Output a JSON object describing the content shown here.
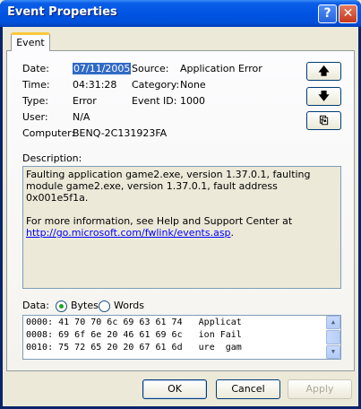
{
  "window": {
    "title": "Event Properties",
    "help_glyph": "?",
    "close_glyph": "✕"
  },
  "tab": {
    "label": "Event"
  },
  "fields": {
    "date_label": "Date:",
    "date_value": "07/11/2005",
    "time_label": "Time:",
    "time_value": "04:31:28",
    "type_label": "Type:",
    "type_value": "Error",
    "user_label": "User:",
    "user_value": "N/A",
    "computer_label": "Computer:",
    "computer_value": "BENQ-2C131923FA",
    "source_label": "Source:",
    "source_value": "Application Error",
    "category_label": "Category:",
    "category_value": "None",
    "eventid_label": "Event ID:",
    "eventid_value": "1000"
  },
  "side_buttons": {
    "up": "🡅",
    "down": "🡇",
    "copy": "⎘"
  },
  "description": {
    "label": "Description:",
    "line1": "Faulting application game2.exe, version 1.37.0.1, faulting module game2.exe, version 1.37.0.1, fault address 0x001e5f1a.",
    "line2": "For more information, see Help and Support Center at",
    "link": "http://go.microsoft.com/fwlink/events.asp",
    "link_suffix": "."
  },
  "data": {
    "label": "Data:",
    "bytes_label": "Bytes",
    "words_label": "Words",
    "selected": "Bytes",
    "rows": [
      "0000: 41 70 70 6c 69 63 61 74   Applicat",
      "0008: 69 6f 6e 20 46 61 69 6c   ion Fail",
      "0010: 75 72 65 20 20 67 61 6d   ure  gam"
    ]
  },
  "buttons": {
    "ok": "OK",
    "cancel": "Cancel",
    "apply": "Apply"
  },
  "colors": {
    "titlebar": "#0054e3",
    "selection": "#316ac5",
    "link": "#0000ff",
    "face": "#ece9d8"
  }
}
